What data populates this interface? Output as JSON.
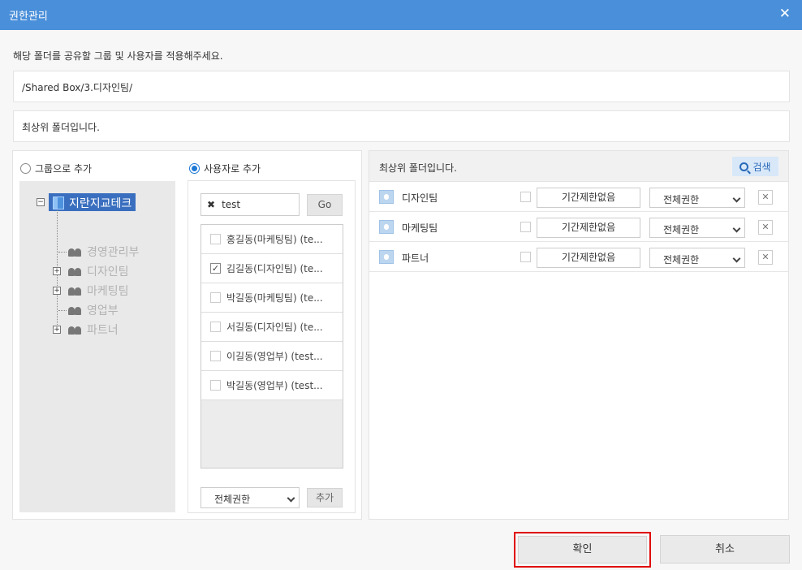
{
  "window": {
    "title": "권한관리",
    "close_symbol": "✕"
  },
  "instruction": "해당 폴더를 공유할 그룹 및 사용자를 적용해주세요.",
  "path": "/Shared Box/3.디자인팀/",
  "info_text": "최상위 폴더입니다.",
  "left": {
    "radio_group_label": "그룹으로 추가",
    "radio_user_label": "사용자로 추가",
    "tree": {
      "root": "지란지교테크",
      "items": [
        {
          "label": "경영관리부",
          "expandable": false
        },
        {
          "label": "디자인팀",
          "expandable": true
        },
        {
          "label": "마케팅팀",
          "expandable": true
        },
        {
          "label": "영업부",
          "expandable": false
        },
        {
          "label": "파트너",
          "expandable": true
        }
      ]
    },
    "search": {
      "value": "test",
      "clear_symbol": "✖",
      "go_label": "Go"
    },
    "users": [
      {
        "label": "홍길동(마케팅팀) (te...",
        "checked": false
      },
      {
        "label": "김길동(디자인팀) (te...",
        "checked": true
      },
      {
        "label": "박길동(마케팅팀) (te...",
        "checked": false
      },
      {
        "label": "서길동(디자인팀) (te...",
        "checked": false
      },
      {
        "label": "이길동(영업부) (test...",
        "checked": false
      },
      {
        "label": "박길동(영업부) (test...",
        "checked": false
      }
    ],
    "permission_select": "전체권한",
    "add_label": "추가"
  },
  "right": {
    "header_label": "최상위 폴더입니다.",
    "search_label": "검색",
    "groups": [
      {
        "name": "디자인팀",
        "period": "기간제한없음",
        "permission": "전체권한"
      },
      {
        "name": "마케팅팀",
        "period": "기간제한없음",
        "permission": "전체권한"
      },
      {
        "name": "파트너",
        "period": "기간제한없음",
        "permission": "전체권한"
      }
    ],
    "remove_symbol": "✕"
  },
  "footer": {
    "confirm_label": "확인",
    "cancel_label": "취소"
  },
  "colors": {
    "titlebar": "#4a8fd9",
    "accent": "#1e78d6",
    "highlight_border": "#e00000"
  }
}
